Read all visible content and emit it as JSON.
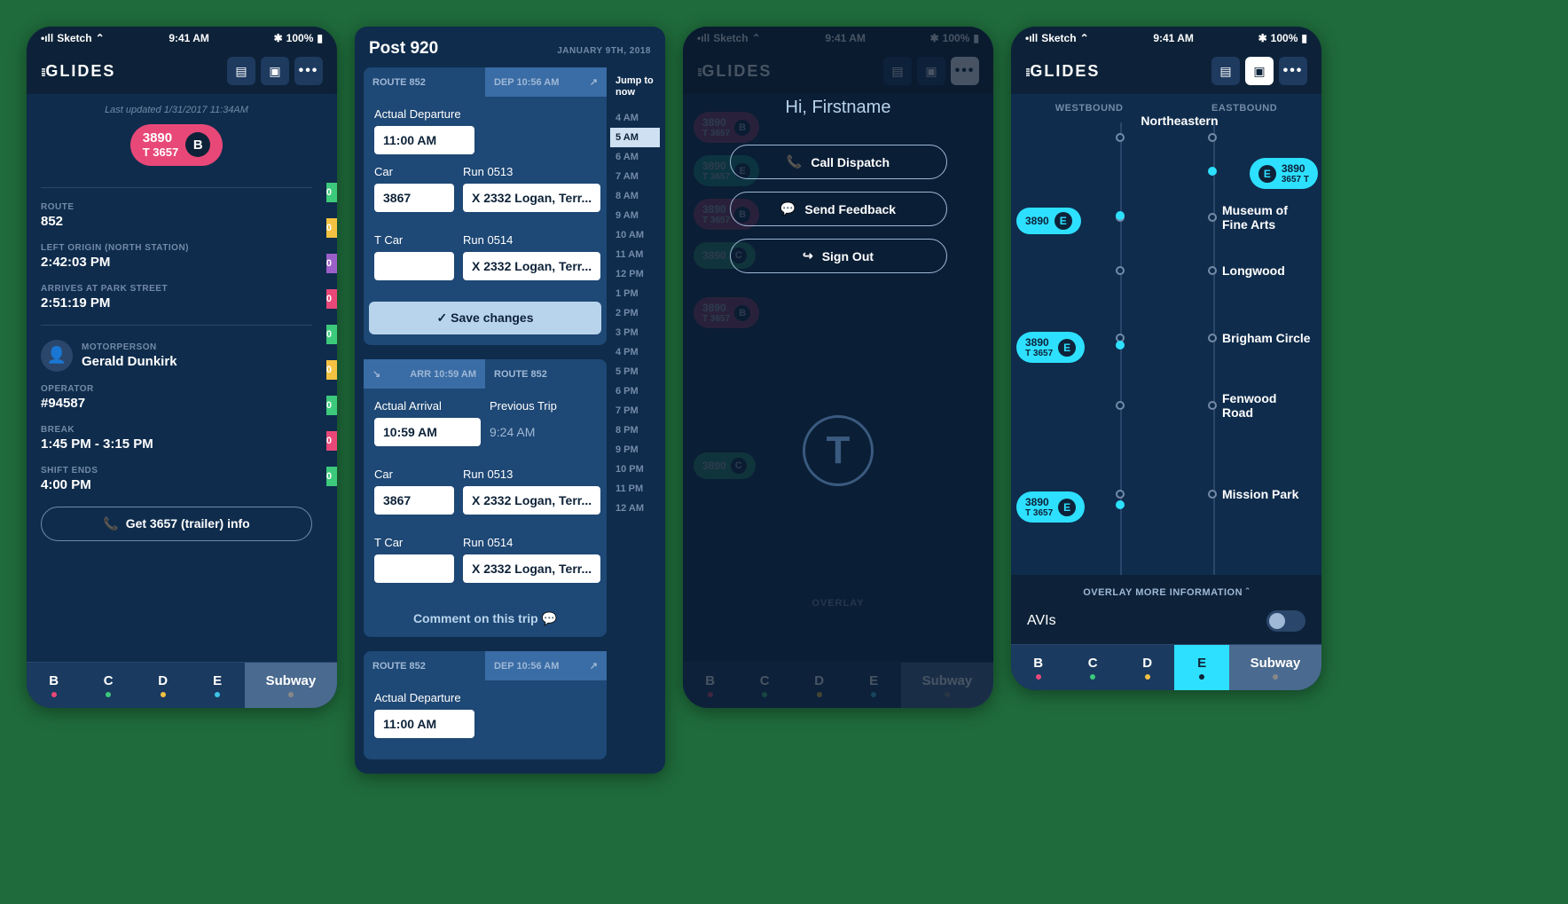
{
  "status_bar": {
    "carrier": "Sketch",
    "time": "9:41 AM",
    "battery": "100%"
  },
  "app_name": "GLIDES",
  "screen1": {
    "last_updated": "Last updated 1/31/2017 11:34AM",
    "vehicle": {
      "num1": "3890",
      "num2": "T 3657",
      "line": "B"
    },
    "route": {
      "label": "ROUTE",
      "value": "852"
    },
    "left_origin": {
      "label": "LEFT ORIGIN (NORTH STATION)",
      "value": "2:42:03 PM"
    },
    "arrives": {
      "label": "ARRIVES AT PARK STREET",
      "value": "2:51:19 PM"
    },
    "motorperson": {
      "label": "MOTORPERSON",
      "value": "Gerald Dunkirk"
    },
    "operator": {
      "label": "OPERATOR",
      "value": "#94587"
    },
    "break": {
      "label": "BREAK",
      "value": "1:45 PM - 3:15 PM"
    },
    "shift_ends": {
      "label": "SHIFT ENDS",
      "value": "4:00 PM"
    },
    "trailer_btn": "Get 3657 (trailer) info"
  },
  "screen2": {
    "title": "Post 920",
    "date": "JANUARY 9TH, 2018",
    "time_jump": "Jump to now",
    "times": [
      "4 AM",
      "5 AM",
      "6 AM",
      "7 AM",
      "8 AM",
      "9 AM",
      "10 AM",
      "11 AM",
      "12 PM",
      "1 PM",
      "2 PM",
      "3 PM",
      "4 PM",
      "5 PM",
      "6 PM",
      "7 PM",
      "8 PM",
      "9 PM",
      "10 PM",
      "11 PM",
      "12 AM"
    ],
    "card1": {
      "route_tab": "ROUTE 852",
      "dep_tab": "DEP 10:56 AM",
      "actual_dep_label": "Actual Departure",
      "actual_dep": "11:00 AM",
      "car_label": "Car",
      "car": "3867",
      "run1_label": "Run 0513",
      "run1": "X   2332   Logan, Terr...",
      "tcar_label": "T Car",
      "run2_label": "Run 0514",
      "run2": "X   2332   Logan, Terr...",
      "save": "Save changes"
    },
    "card2": {
      "arr_tab": "ARR 10:59 AM",
      "route_tab": "ROUTE 852",
      "actual_arr_label": "Actual Arrival",
      "actual_arr": "10:59 AM",
      "prev_label": "Previous Trip",
      "prev": "9:24 AM",
      "car_label": "Car",
      "car": "3867",
      "run1_label": "Run 0513",
      "run1": "X   2332   Logan, Terr...",
      "tcar_label": "T Car",
      "run2_label": "Run 0514",
      "run2": "X   2332   Logan, Terr...",
      "comment": "Comment on this trip"
    },
    "card3": {
      "route_tab": "ROUTE 852",
      "dep_tab": "DEP 10:56 AM",
      "actual_dep_label": "Actual Departure",
      "actual_dep": "11:00 AM"
    }
  },
  "screen3": {
    "greeting": "Hi, Firstname",
    "call_dispatch": "Call Dispatch",
    "send_feedback": "Send Feedback",
    "sign_out": "Sign Out",
    "overlay": "OVERLAY"
  },
  "screen4": {
    "westbound": "WESTBOUND",
    "eastbound": "EASTBOUND",
    "stops": [
      "Northeastern",
      "Museum of Fine Arts",
      "Longwood",
      "Brigham Circle",
      "Fenwood Road",
      "Mission Park"
    ],
    "overlay_head": "OVERLAY MORE INFORMATION",
    "avis": "AVIs",
    "markers": {
      "n1": "3890",
      "n2": "3657",
      "line": "E"
    }
  },
  "nav": {
    "b": "B",
    "c": "C",
    "d": "D",
    "e": "E",
    "subway": "Subway"
  }
}
